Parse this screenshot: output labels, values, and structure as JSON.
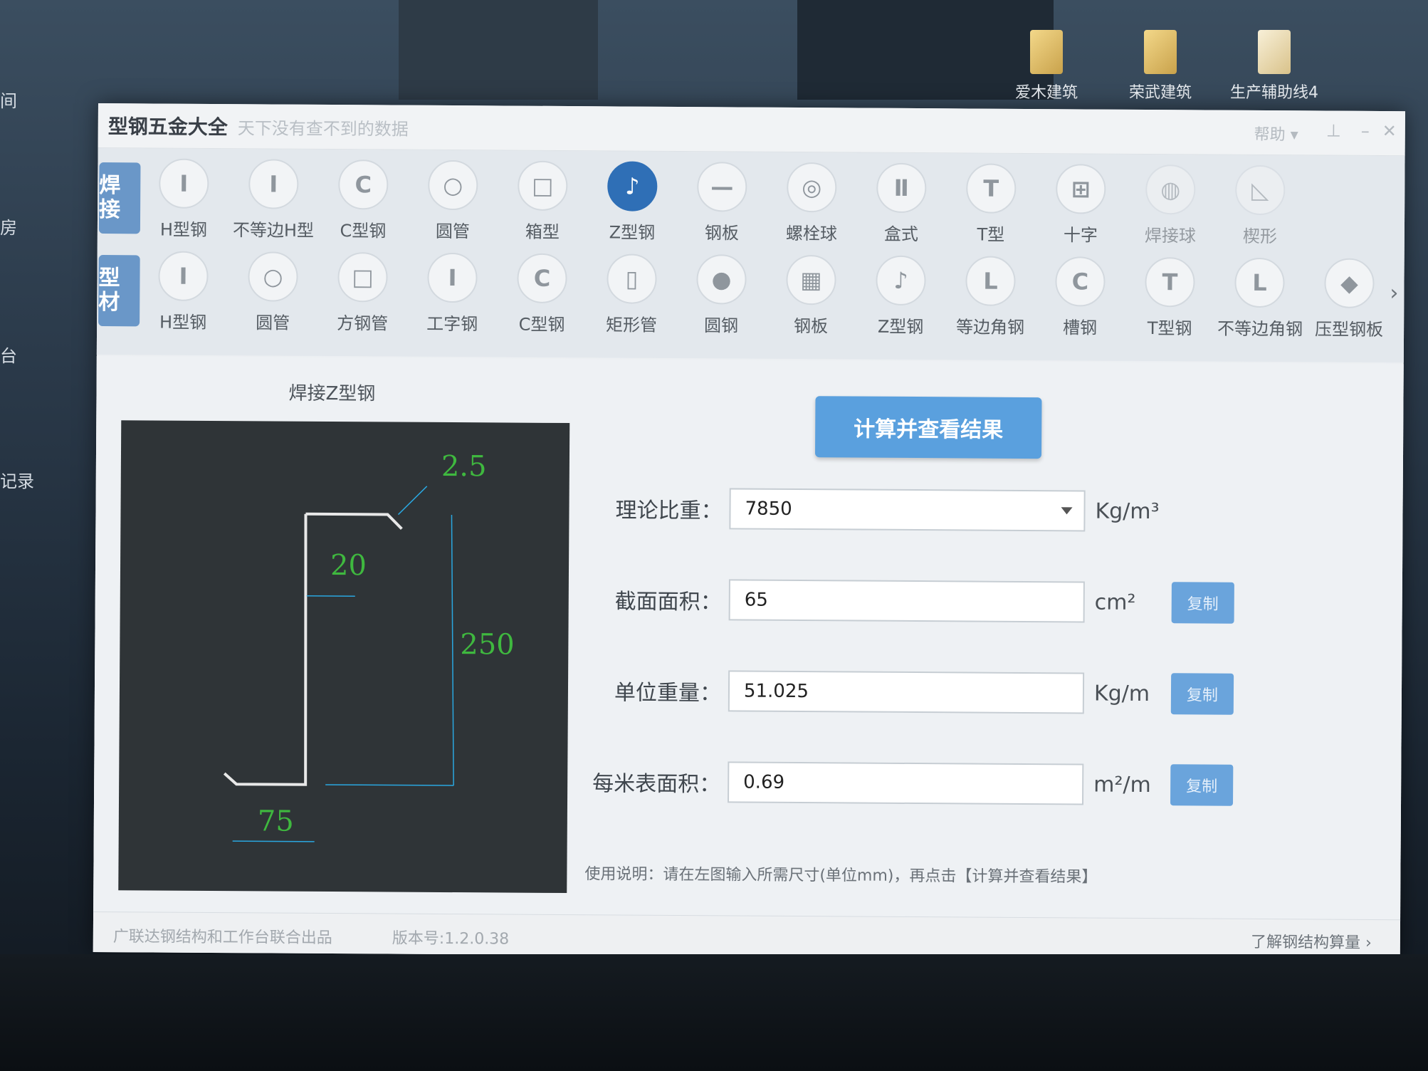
{
  "desktop": {
    "icons": [
      {
        "label": "爱木建筑"
      },
      {
        "label": "荣武建筑"
      },
      {
        "label": "生产辅助线4"
      }
    ],
    "left_labels": [
      "间",
      "房",
      "台",
      "记录"
    ]
  },
  "app": {
    "title": "型钢五金大全",
    "slogan": "天下没有查不到的数据",
    "help_label": "帮助"
  },
  "toolbar": {
    "weld_tag": "焊接",
    "profile_tag": "型材",
    "weld_items": [
      {
        "label": "H型钢",
        "icon": "I"
      },
      {
        "label": "不等边H型",
        "icon": "I"
      },
      {
        "label": "C型钢",
        "icon": "C"
      },
      {
        "label": "圆管",
        "icon": "○"
      },
      {
        "label": "箱型",
        "icon": "□"
      },
      {
        "label": "Z型钢",
        "icon": "♪"
      },
      {
        "label": "钢板",
        "icon": "—"
      },
      {
        "label": "螺栓球",
        "icon": "◎"
      },
      {
        "label": "盒式",
        "icon": "Ⅱ"
      },
      {
        "label": "T型",
        "icon": "T"
      },
      {
        "label": "十字",
        "icon": "⊞"
      },
      {
        "label": "焊接球",
        "icon": "◍"
      },
      {
        "label": "楔形",
        "icon": "◺"
      }
    ],
    "profile_items": [
      {
        "label": "H型钢",
        "icon": "I"
      },
      {
        "label": "圆管",
        "icon": "○"
      },
      {
        "label": "方钢管",
        "icon": "□"
      },
      {
        "label": "工字钢",
        "icon": "I"
      },
      {
        "label": "C型钢",
        "icon": "C"
      },
      {
        "label": "矩形管",
        "icon": "▯"
      },
      {
        "label": "圆钢",
        "icon": "●"
      },
      {
        "label": "钢板",
        "icon": "▦"
      },
      {
        "label": "Z型钢",
        "icon": "♪"
      },
      {
        "label": "等边角钢",
        "icon": "L"
      },
      {
        "label": "槽钢",
        "icon": "C"
      },
      {
        "label": "T型钢",
        "icon": "T"
      },
      {
        "label": "不等边角钢",
        "icon": "L"
      },
      {
        "label": "压型钢板",
        "icon": "◆"
      }
    ],
    "active": "Z型钢"
  },
  "drawing": {
    "title": "焊接Z型钢",
    "dim_thickness": "2.5",
    "dim_lip": "20",
    "dim_height": "250",
    "dim_flange": "75",
    "line_color": "#e8e8e8",
    "dim_color": "#3fb83f",
    "marker_color": "#2aa7e0"
  },
  "form": {
    "calc_button": "计算并查看结果",
    "fields": [
      {
        "label": "理论比重：",
        "value": "7850",
        "unit": "Kg/m³",
        "copy": ""
      },
      {
        "label": "截面面积：",
        "value": "65",
        "unit": "cm²",
        "copy": "复制"
      },
      {
        "label": "单位重量：",
        "value": "51.025",
        "unit": "Kg/m",
        "copy": "复制"
      },
      {
        "label": "每米表面积：",
        "value": "0.69",
        "unit": "m²/m",
        "copy": "复制"
      }
    ],
    "usage": "使用说明：请在左图输入所需尺寸(单位mm)，再点击【计算并查看结果】"
  },
  "status": {
    "credit": "广联达钢结构和工作台联合出品",
    "version": "版本号:1.2.0.38",
    "learn_link": "了解钢结构算量"
  }
}
